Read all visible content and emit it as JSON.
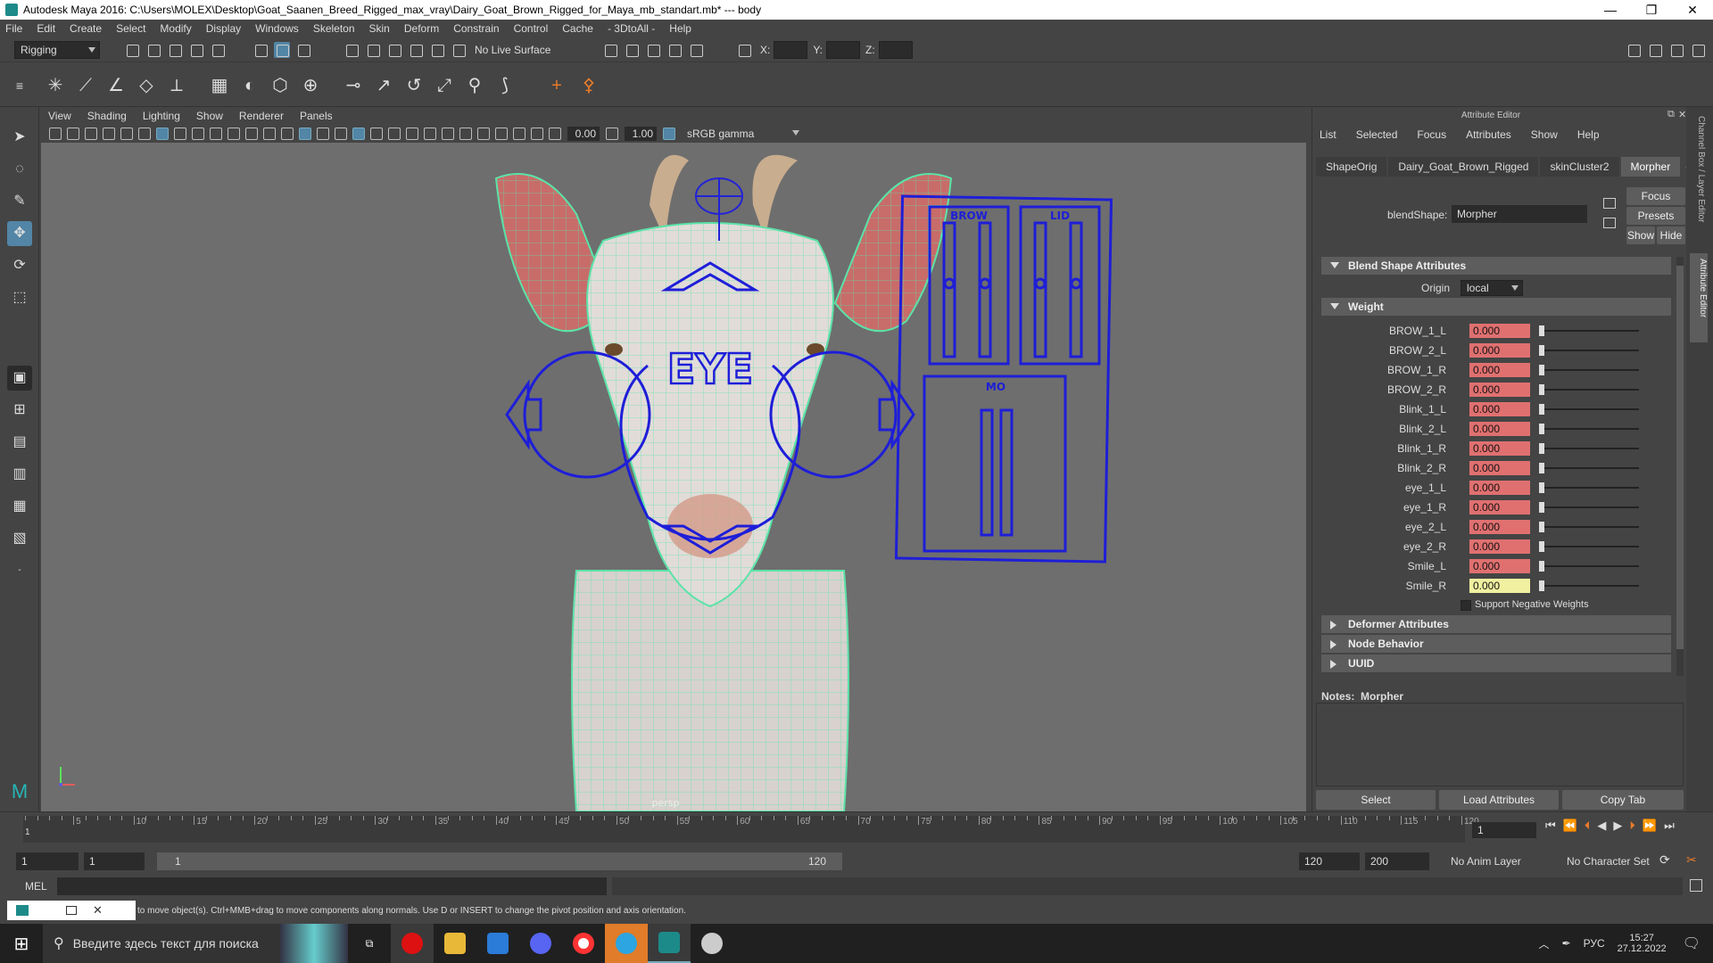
{
  "window": {
    "title": "Autodesk Maya 2016: C:\\Users\\MOLEX\\Desktop\\Goat_Saanen_Breed_Rigged_max_vray\\Dairy_Goat_Brown_Rigged_for_Maya_mb_standart.mb*   ---   body",
    "min_label": "—",
    "max_label": "❐",
    "close_label": "✕"
  },
  "menubar": [
    "File",
    "Edit",
    "Create",
    "Select",
    "Modify",
    "Display",
    "Windows",
    "Skeleton",
    "Skin",
    "Deform",
    "Constrain",
    "Control",
    "Cache",
    "- 3DtoAll -",
    "Help"
  ],
  "statusline": {
    "menuset": "Rigging",
    "live_surface": "No Live Surface",
    "x_label": "X:",
    "y_label": "Y:",
    "z_label": "Z:"
  },
  "viewport": {
    "menu": [
      "View",
      "Shading",
      "Lighting",
      "Show",
      "Renderer",
      "Panels"
    ],
    "field1": "0.00",
    "field2": "1.00",
    "color_mgmt": "sRGB gamma",
    "camera_label": "persp",
    "eye_label": "EYE",
    "brow_label": "BROW",
    "lid_label": "LID",
    "mouth_label": "MO"
  },
  "attribute_editor": {
    "title": "Attribute Editor",
    "menu": [
      "List",
      "Selected",
      "Focus",
      "Attributes",
      "Show",
      "Help"
    ],
    "tabs": [
      "ShapeOrig",
      "Dairy_Goat_Brown_Rigged",
      "skinCluster2",
      "Morpher"
    ],
    "selected_tab": "Morpher",
    "node_label": "blendShape:",
    "node_value": "Morpher",
    "focus_btn": "Focus",
    "presets_btn": "Presets",
    "show_btn": "Show",
    "hide_btn": "Hide",
    "section_blend": "Blend Shape Attributes",
    "origin_label": "Origin",
    "origin_value": "local",
    "section_weight": "Weight",
    "weights": [
      {
        "name": "BROW_1_L",
        "value": "0.000"
      },
      {
        "name": "BROW_2_L",
        "value": "0.000"
      },
      {
        "name": "BROW_1_R",
        "value": "0.000"
      },
      {
        "name": "BROW_2_R",
        "value": "0.000"
      },
      {
        "name": "Blink_1_L",
        "value": "0.000"
      },
      {
        "name": "Blink_2_L",
        "value": "0.000"
      },
      {
        "name": "Blink_1_R",
        "value": "0.000"
      },
      {
        "name": "Blink_2_R",
        "value": "0.000"
      },
      {
        "name": "eye_1_L",
        "value": "0.000"
      },
      {
        "name": "eye_1_R",
        "value": "0.000"
      },
      {
        "name": "eye_2_L",
        "value": "0.000"
      },
      {
        "name": "eye_2_R",
        "value": "0.000"
      },
      {
        "name": "Smile_L",
        "value": "0.000"
      },
      {
        "name": "Smile_R",
        "value": "0.000"
      }
    ],
    "support_negative": "Support Negative Weights",
    "section_deformer": "Deformer Attributes",
    "section_node": "Node Behavior",
    "section_uuid": "UUID",
    "notes_label": "Notes:",
    "notes_value": "Morpher",
    "select_btn": "Select",
    "load_btn": "Load Attributes",
    "copy_btn": "Copy Tab",
    "side_tab_channel": "Channel Box / Layer Editor",
    "side_tab_attr": "Attribute Editor"
  },
  "timeline": {
    "ticks": [
      "5",
      "10",
      "15",
      "20",
      "25",
      "30",
      "35",
      "40",
      "45",
      "50",
      "55",
      "60",
      "65",
      "70",
      "75",
      "80",
      "85",
      "90",
      "95",
      "100",
      "105",
      "110",
      "115",
      "120"
    ],
    "start_frame": "1",
    "current_frame": "1",
    "range_start": "1",
    "range_start2": "1",
    "range_slider_start": "1",
    "range_slider_end": "120",
    "range_end": "120",
    "anim_end": "200",
    "anim_layer": "No Anim Layer",
    "char_set": "No Character Set"
  },
  "cmd": {
    "label": "MEL"
  },
  "help": {
    "text": "to move object(s). Ctrl+MMB+drag to move components along normals. Use D or INSERT to change the pivot position and axis orientation."
  },
  "taskbar": {
    "search": "Введите здесь текст для поиска",
    "lang": "РУС",
    "time": "15:27",
    "date": "27.12.2022"
  }
}
